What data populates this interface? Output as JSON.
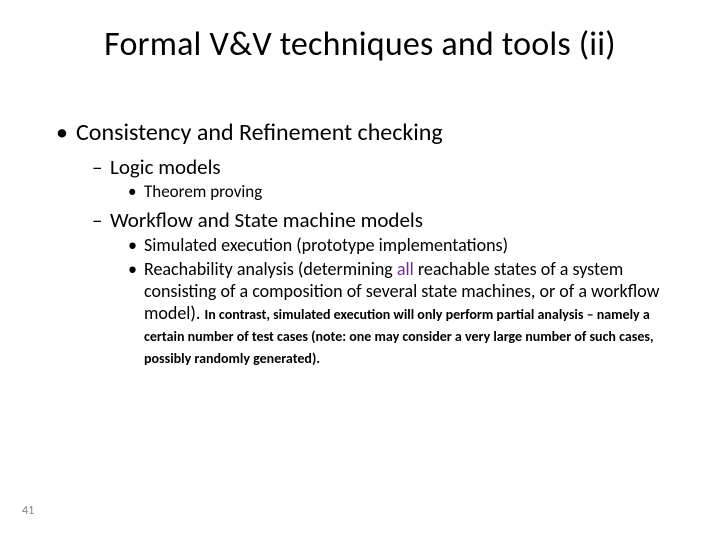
{
  "title": "Formal V&V techniques and tools (ii)",
  "content": {
    "l1": "Consistency and Refinement checking",
    "l2a": "Logic models",
    "l3a": "Theorem proving",
    "l2b": "Workflow and State machine models",
    "l3b": "Simulated execution (prototype implementations)",
    "l3c_pre": "Reachability analysis (determining ",
    "l3c_accent": "all",
    "l3c_post": " reachable states of a system consisting of a composition of several state machines, or of a workflow model). ",
    "l3c_note": "In contrast, simulated execution will only perform partial analysis – namely a certain number of test cases (note: one may consider a very large number of such cases, possibly randomly generated)."
  },
  "page_number": "41",
  "bullets": {
    "dot": "•",
    "dash": "–"
  }
}
